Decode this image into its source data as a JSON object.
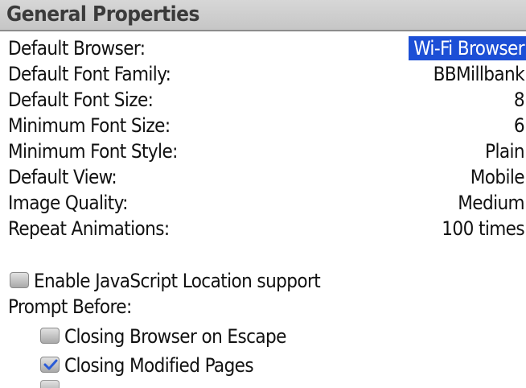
{
  "header": {
    "title": "General Properties"
  },
  "properties": [
    {
      "label": "Default Browser:",
      "value": "Wi-Fi Browser"
    },
    {
      "label": "Default Font Family:",
      "value": "BBMillbank"
    },
    {
      "label": "Default Font Size:",
      "value": "8"
    },
    {
      "label": "Minimum Font Size:",
      "value": "6"
    },
    {
      "label": "Minimum Font Style:",
      "value": "Plain"
    },
    {
      "label": "Default View:",
      "value": "Mobile"
    },
    {
      "label": "Image Quality:",
      "value": "Medium"
    },
    {
      "label": "Repeat Animations:",
      "value": "100 times"
    }
  ],
  "javascript_location": {
    "label": "Enable JavaScript Location support",
    "checked": false
  },
  "prompt_before": {
    "label": "Prompt Before:",
    "options": [
      {
        "label": "Closing Browser on Escape",
        "checked": false
      },
      {
        "label": "Closing Modified Pages",
        "checked": true
      }
    ]
  },
  "colors": {
    "selection": "#1c4fd6",
    "check": "#2a5bd7"
  }
}
